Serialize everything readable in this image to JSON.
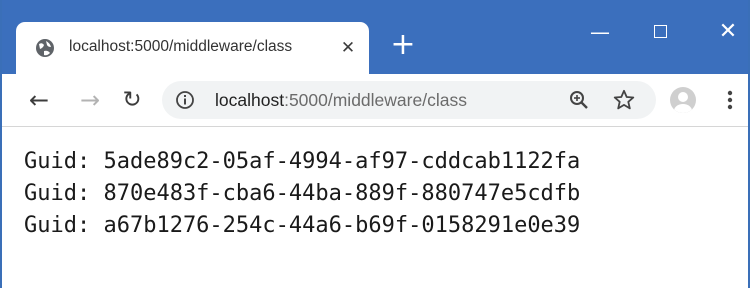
{
  "colors": {
    "titlebar": "#3b6fbd",
    "omnibox": "#f1f3f4",
    "url_host": "#222222",
    "url_rest": "#6b6b6b"
  },
  "tab": {
    "title": "localhost:5000/middleware/class",
    "favicon": "globe-icon",
    "close_glyph": "✕"
  },
  "window_controls": {
    "new_tab_glyph": "+",
    "minimize_glyph": "—",
    "close_glyph": "✕"
  },
  "toolbar": {
    "back_glyph": "←",
    "forward_glyph": "→",
    "reload_glyph": "↻",
    "address": {
      "host": "localhost",
      "rest": ":5000/middleware/class"
    },
    "icons": [
      "info-icon",
      "zoom-icon",
      "star-icon",
      "avatar",
      "menu-icon"
    ]
  },
  "content": {
    "lines": [
      "Guid: 5ade89c2-05af-4994-af97-cddcab1122fa",
      "Guid: 870e483f-cba6-44ba-889f-880747e5cdfb",
      "Guid: a67b1276-254c-44a6-b69f-0158291e0e39"
    ]
  }
}
